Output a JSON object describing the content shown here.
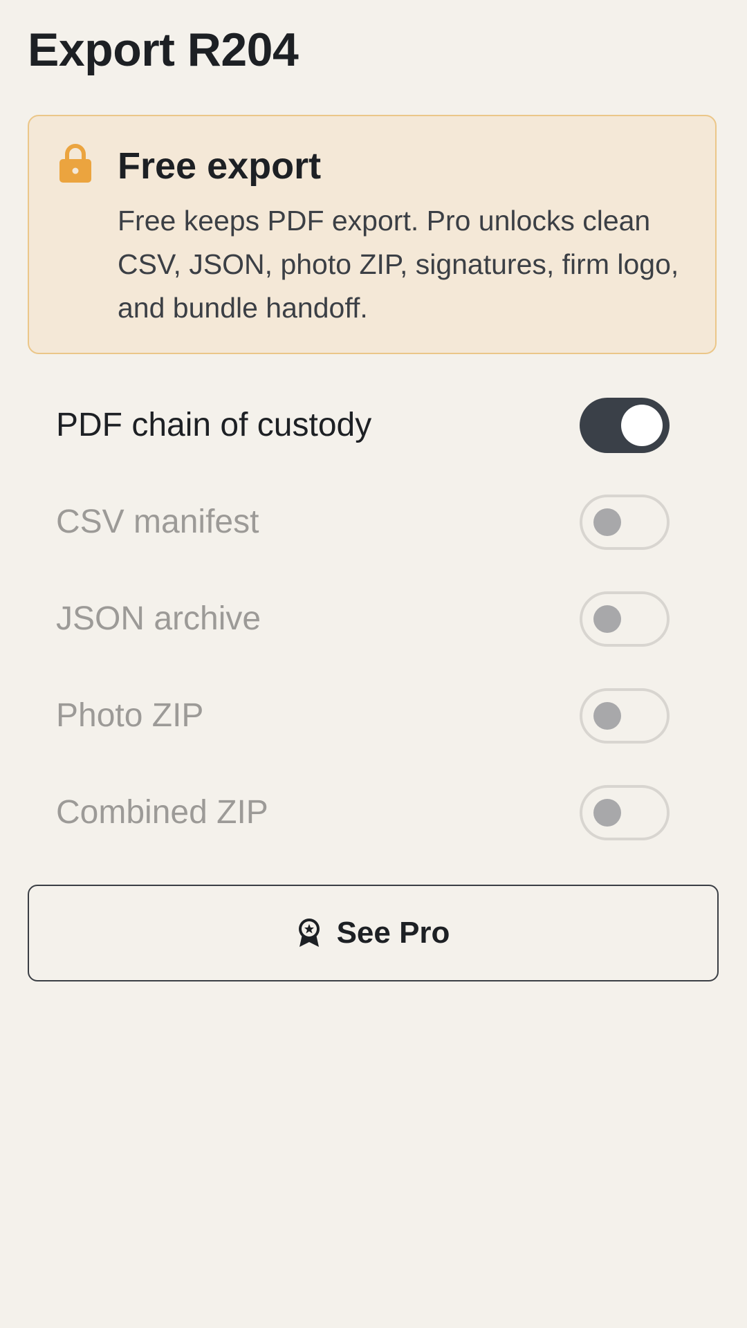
{
  "page": {
    "title": "Export R204"
  },
  "notice": {
    "icon": "lock-icon",
    "title": "Free export",
    "body": "Free keeps PDF export. Pro unlocks clean CSV, JSON, photo ZIP, signatures, firm logo, and bundle handoff."
  },
  "toggles": [
    {
      "label": "PDF chain of custody",
      "state": "on",
      "enabled": true
    },
    {
      "label": "CSV manifest",
      "state": "off",
      "enabled": false
    },
    {
      "label": "JSON archive",
      "state": "off",
      "enabled": false
    },
    {
      "label": "Photo ZIP",
      "state": "off",
      "enabled": false
    },
    {
      "label": "Combined ZIP",
      "state": "off",
      "enabled": false
    }
  ],
  "cta": {
    "icon": "award-icon",
    "label": "See Pro"
  },
  "colors": {
    "background": "#f4f1eb",
    "notice_background": "#f4e8d7",
    "notice_border": "#ebc688",
    "lock_icon": "#eba43f",
    "switch_on": "#3a4048",
    "text_disabled": "#9c9a97"
  }
}
